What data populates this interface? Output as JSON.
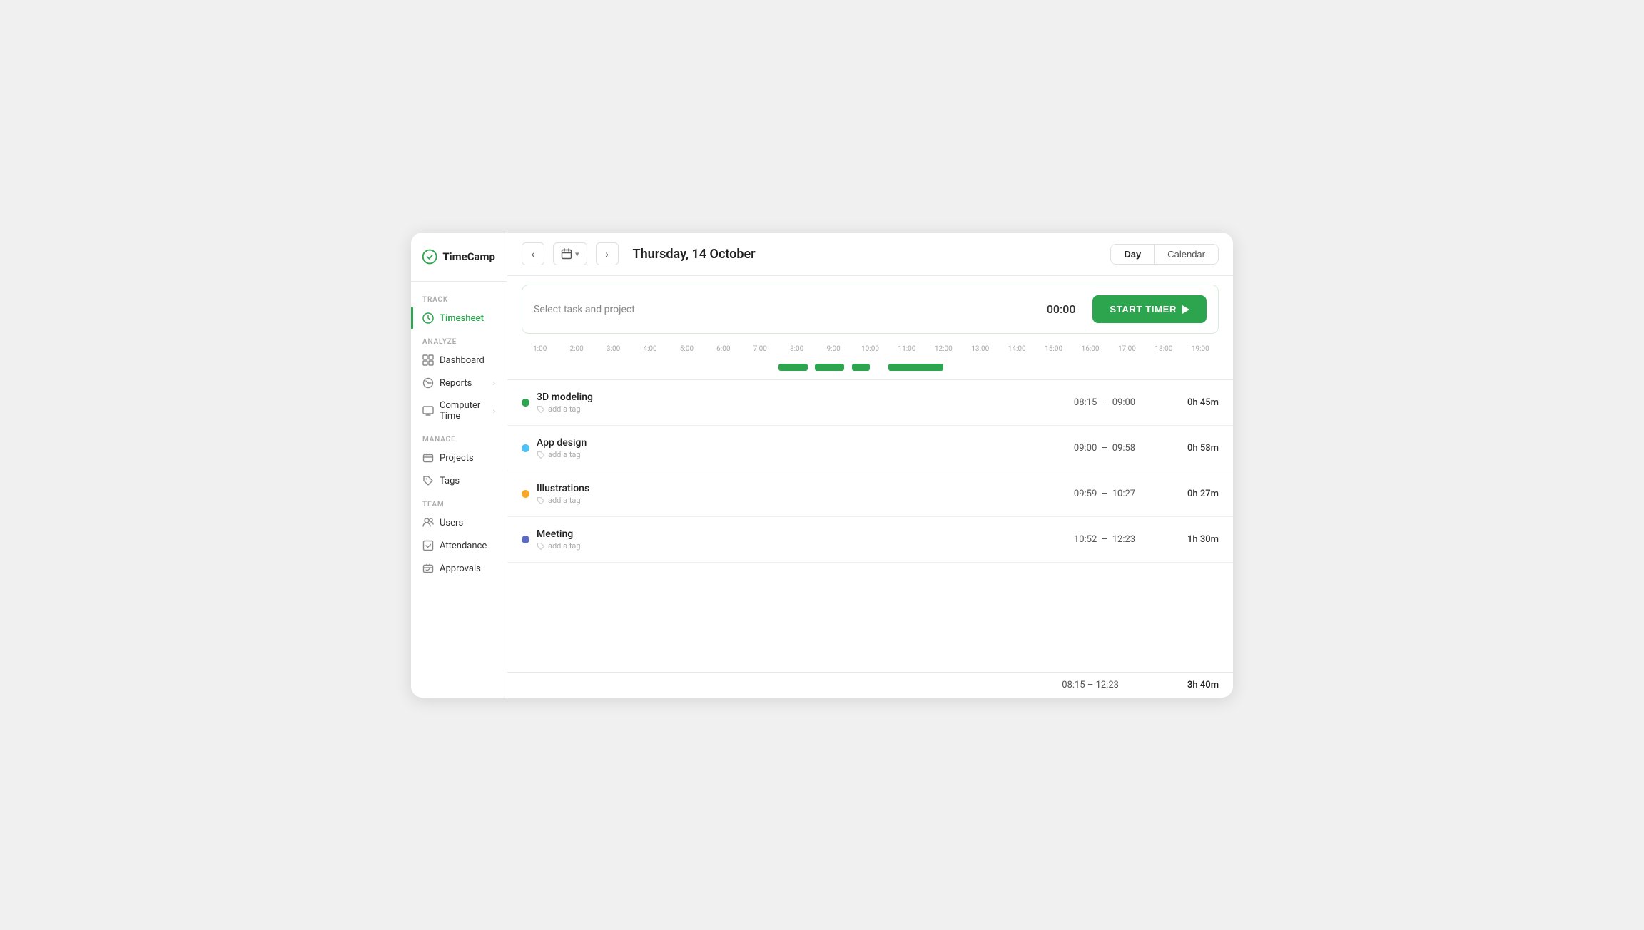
{
  "app": {
    "name": "TimeCamp"
  },
  "sidebar": {
    "sections": [
      {
        "label": "TRACK",
        "items": [
          {
            "id": "timesheet",
            "label": "Timesheet",
            "active": true,
            "hasChevron": false
          }
        ]
      },
      {
        "label": "ANALYZE",
        "items": [
          {
            "id": "dashboard",
            "label": "Dashboard",
            "active": false,
            "hasChevron": false
          },
          {
            "id": "reports",
            "label": "Reports",
            "active": false,
            "hasChevron": true
          },
          {
            "id": "computer-time",
            "label": "Computer Time",
            "active": false,
            "hasChevron": true
          }
        ]
      },
      {
        "label": "MANAGE",
        "items": [
          {
            "id": "projects",
            "label": "Projects",
            "active": false,
            "hasChevron": false
          },
          {
            "id": "tags",
            "label": "Tags",
            "active": false,
            "hasChevron": false
          }
        ]
      },
      {
        "label": "TEAM",
        "items": [
          {
            "id": "users",
            "label": "Users",
            "active": false,
            "hasChevron": false
          },
          {
            "id": "attendance",
            "label": "Attendance",
            "active": false,
            "hasChevron": false
          },
          {
            "id": "approvals",
            "label": "Approvals",
            "active": false,
            "hasChevron": false
          }
        ]
      }
    ]
  },
  "header": {
    "date": "Thursday, 14 October",
    "view_day": "Day",
    "view_calendar": "Calendar"
  },
  "timer": {
    "placeholder": "Select task and project",
    "time": "00:00",
    "button_label": "START TIMER"
  },
  "timeline": {
    "hours": [
      "1:00",
      "2:00",
      "3:00",
      "4:00",
      "5:00",
      "6:00",
      "7:00",
      "8:00",
      "9:00",
      "10:00",
      "11:00",
      "12:00",
      "13:00",
      "14:00",
      "15:00",
      "16:00",
      "17:00",
      "18:00",
      "19:00"
    ],
    "bars": [
      {
        "start_pct": 36.8,
        "width_pct": 4.2,
        "color": "#2da44e"
      },
      {
        "start_pct": 42.1,
        "width_pct": 4.2,
        "color": "#2da44e"
      },
      {
        "start_pct": 47.4,
        "width_pct": 2.6,
        "color": "#2da44e"
      },
      {
        "start_pct": 52.6,
        "width_pct": 7.9,
        "color": "#2da44e"
      }
    ]
  },
  "tasks": [
    {
      "id": "3d-modeling",
      "name": "3D modeling",
      "tag": "add a tag",
      "dot_color": "#2da44e",
      "start": "08:15",
      "end": "09:00",
      "duration": "0h 45m"
    },
    {
      "id": "app-design",
      "name": "App design",
      "tag": "add a tag",
      "dot_color": "#4fc3f7",
      "start": "09:00",
      "end": "09:58",
      "duration": "0h 58m"
    },
    {
      "id": "illustrations",
      "name": "Illustrations",
      "tag": "add a tag",
      "dot_color": "#f9a825",
      "start": "09:59",
      "end": "10:27",
      "duration": "0h 27m"
    },
    {
      "id": "meeting",
      "name": "Meeting",
      "tag": "add a tag",
      "dot_color": "#5c6bc0",
      "start": "10:52",
      "end": "12:23",
      "duration": "1h 30m"
    }
  ],
  "footer": {
    "time_range": "08:15  –  12:23",
    "total": "3h 40m"
  }
}
